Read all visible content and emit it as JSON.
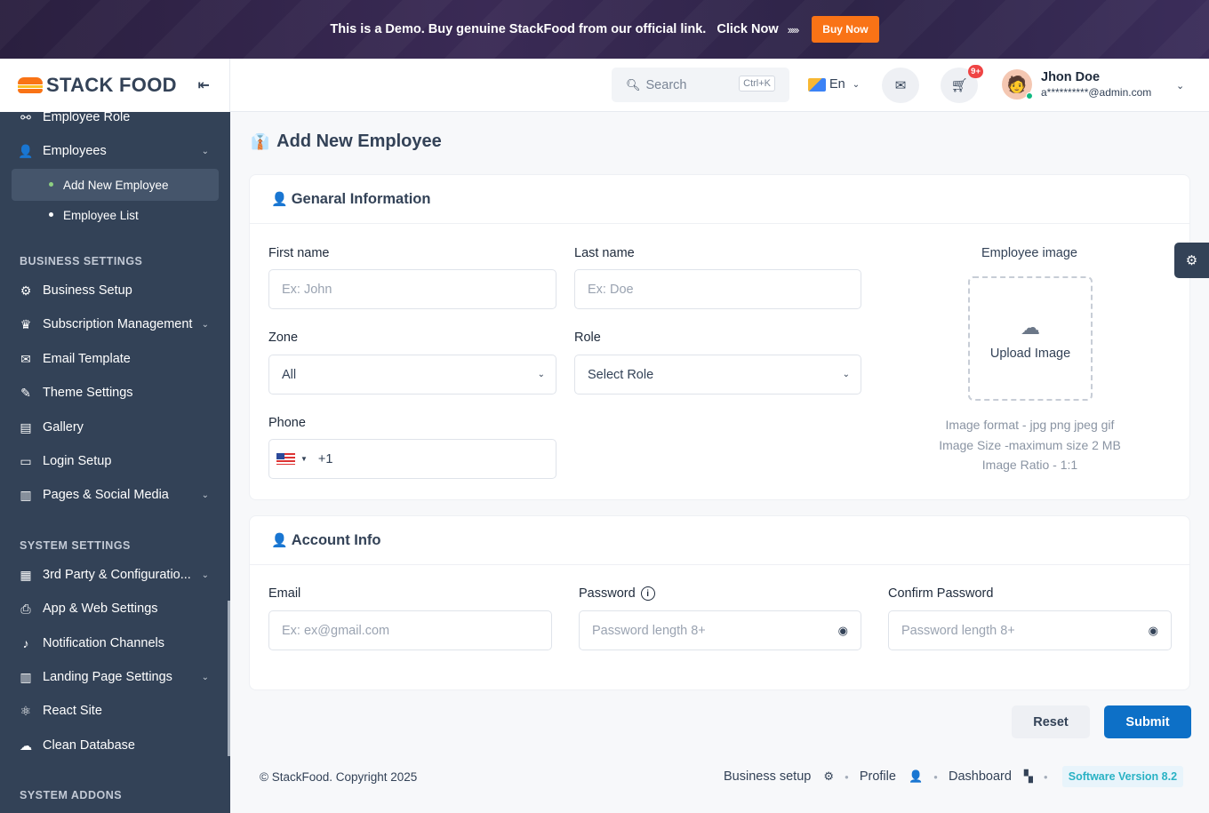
{
  "banner": {
    "text": "This is a Demo. Buy genuine StackFood from our official link.",
    "click_now": "Click Now",
    "arrows": "›››››",
    "buy_now": "Buy Now"
  },
  "brand": {
    "logo_text": "STACK FOOD",
    "collapse_glyph": "⇤"
  },
  "sidebar": {
    "employee_role": "Employee Role",
    "employees": "Employees",
    "add_new_employee": "Add New Employee",
    "employee_list": "Employee List",
    "business_section": "BUSINESS SETTINGS",
    "business_items": [
      {
        "label": "Business Setup",
        "icon": "gear-icon",
        "glyph": "⚙"
      },
      {
        "label": "Subscription Management",
        "icon": "crown-icon",
        "glyph": "♛"
      },
      {
        "label": "Email Template",
        "icon": "mail-icon",
        "glyph": "✉"
      },
      {
        "label": "Theme Settings",
        "icon": "brush-icon",
        "glyph": "✎"
      },
      {
        "label": "Gallery",
        "icon": "gallery-icon",
        "glyph": "▤"
      },
      {
        "label": "Login Setup",
        "icon": "monitor-icon",
        "glyph": "▭"
      },
      {
        "label": "Pages & Social Media",
        "icon": "pages-icon",
        "glyph": "▥"
      }
    ],
    "system_section": "SYSTEM SETTINGS",
    "system_items": [
      {
        "label": "3rd Party & Configuratio...",
        "icon": "config-icon",
        "glyph": "▦"
      },
      {
        "label": "App & Web Settings",
        "icon": "printer-icon",
        "glyph": "⎙"
      },
      {
        "label": "Notification Channels",
        "icon": "bell-icon",
        "glyph": "🔔"
      },
      {
        "label": "Landing Page Settings",
        "icon": "pages-icon",
        "glyph": "▥"
      },
      {
        "label": "React Site",
        "icon": "react-icon",
        "glyph": "⚛"
      },
      {
        "label": "Clean Database",
        "icon": "cloud-icon",
        "glyph": "☁"
      }
    ],
    "addons_section": "SYSTEM ADDONS"
  },
  "header": {
    "search_placeholder": "Search",
    "search_shortcut": "Ctrl+K",
    "language": "En",
    "cart_badge": "9+",
    "user_name": "Jhon Doe",
    "user_email": "a**********@admin.com"
  },
  "page": {
    "title": "Add New Employee",
    "general_title": "Genaral Information",
    "first_name_label": "First name",
    "first_name_placeholder": "Ex: John",
    "last_name_label": "Last name",
    "last_name_placeholder": "Ex: Doe",
    "zone_label": "Zone",
    "zone_value": "All",
    "role_label": "Role",
    "role_value": "Select Role",
    "phone_label": "Phone",
    "phone_code": "+1",
    "employee_image_label": "Employee image",
    "upload_text": "Upload Image",
    "image_format": "Image format - jpg png jpeg gif",
    "image_size": "Image Size -maximum size 2 MB",
    "image_ratio": "Image Ratio - 1:1",
    "account_title": "Account Info",
    "email_label": "Email",
    "email_placeholder": "Ex: ex@gmail.com",
    "password_label": "Password",
    "password_placeholder": "Password length 8+",
    "confirm_label": "Confirm Password",
    "confirm_placeholder": "Password length 8+",
    "reset": "Reset",
    "submit": "Submit"
  },
  "footer": {
    "copyright": "© StackFood. Copyright 2025",
    "business_setup": "Business setup",
    "profile": "Profile",
    "dashboard": "Dashboard",
    "version": "Software Version 8.2"
  },
  "colors": {
    "sidebar": "#334257",
    "primary": "#0d70c7",
    "accent": "#f97316"
  }
}
